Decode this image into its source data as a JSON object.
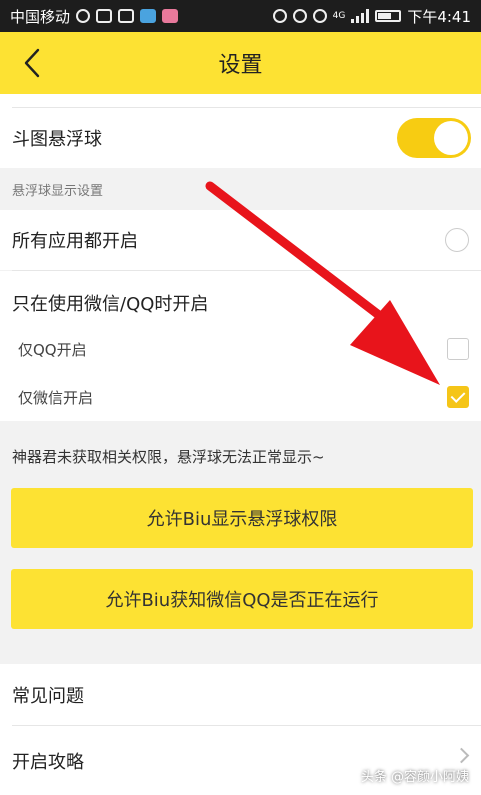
{
  "status_bar": {
    "carrier": "中国移动",
    "network": "4G",
    "time": "下午4:41"
  },
  "header": {
    "title": "设置"
  },
  "float_ball": {
    "label": "斗图悬浮球",
    "enabled": true
  },
  "section": {
    "title": "悬浮球显示设置"
  },
  "options": {
    "all_apps": "所有应用都开启",
    "wechat_qq_only": "只在使用微信/QQ时开启",
    "qq_only": "仅QQ开启",
    "wechat_only": "仅微信开启"
  },
  "notice": "神器君未获取相关权限，悬浮球无法正常显示~",
  "buttons": {
    "float_permission": "允许Biu显示悬浮球权限",
    "running_permission": "允许Biu获知微信QQ是否正在运行"
  },
  "faq": {
    "title": "常见问题",
    "guide": "开启攻略"
  },
  "watermark": "头条 @容颜小阿姨",
  "colors": {
    "accent": "#fde233",
    "toggle_on": "#f7cc12",
    "arrow": "#e8141b"
  }
}
